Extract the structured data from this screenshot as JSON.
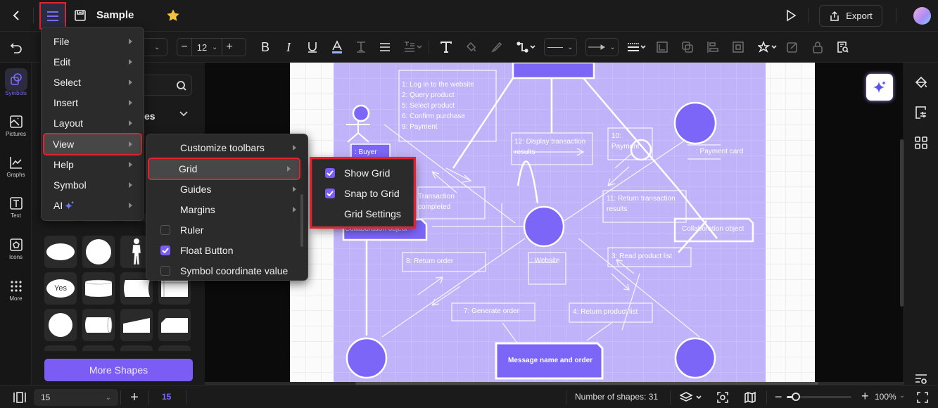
{
  "app": {
    "document_title": "Sample",
    "export_label": "Export"
  },
  "toolbar": {
    "font_size": "12",
    "line_style": "solid",
    "arrow_style": "arrow"
  },
  "left_rail": {
    "items": [
      {
        "label": "Symbols",
        "icon": "symbols-icon",
        "active": true
      },
      {
        "label": "Pictures",
        "icon": "pictures-icon"
      },
      {
        "label": "Graphs",
        "icon": "graphs-icon"
      },
      {
        "label": "Text",
        "icon": "text-icon"
      },
      {
        "label": "Icons",
        "icon": "icons-icon"
      },
      {
        "label": "More",
        "icon": "more-icon"
      }
    ]
  },
  "left_panel": {
    "section_partial_label": "es",
    "yes_shape_label": "Yes",
    "more_shapes_label": "More Shapes"
  },
  "main_menu": {
    "items": [
      {
        "label": "File"
      },
      {
        "label": "Edit"
      },
      {
        "label": "Select"
      },
      {
        "label": "Insert"
      },
      {
        "label": "Layout"
      },
      {
        "label": "View",
        "highlighted": true
      },
      {
        "label": "Help"
      },
      {
        "label": "Symbol"
      },
      {
        "label": "AI"
      }
    ]
  },
  "view_menu": {
    "items": [
      {
        "label": "Customize toolbars",
        "type": "submenu"
      },
      {
        "label": "Grid",
        "type": "submenu",
        "highlighted": true
      },
      {
        "label": "Guides",
        "type": "submenu"
      },
      {
        "label": "Margins",
        "type": "submenu"
      },
      {
        "label": "Ruler",
        "type": "checkbox",
        "checked": false
      },
      {
        "label": "Float Button",
        "type": "checkbox",
        "checked": true
      },
      {
        "label": "Symbol coordinate value",
        "type": "checkbox",
        "checked": false
      }
    ]
  },
  "grid_menu": {
    "items": [
      {
        "label": "Show Grid",
        "checked": true
      },
      {
        "label": "Snap to Grid",
        "checked": true
      },
      {
        "label": "Grid Settings"
      }
    ]
  },
  "diagram": {
    "note_messages": [
      "1: Log in to the website",
      "2: Query product",
      "5: Select product",
      "6: Confirm purchase",
      "9: Payment"
    ],
    "buyer_label": ": Buyer",
    "display_results": "12: Display transaction results",
    "payment_label": "10: Payment",
    "payment_card_label": ": Payment card",
    "transaction_completed": "Transaction completed",
    "return_transaction": "11: Return transaction results",
    "collab_left": "Collaboration object",
    "collab_right": "Collaboration object",
    "website_label": ": Website",
    "return_order": "8: Return order",
    "read_product_list": "3: Read product list",
    "generate_order": "7: Generate order",
    "return_product_list": "4: Return product list",
    "message_name_order": "Message name and order"
  },
  "statusbar": {
    "page_select": "15",
    "page_number": "15",
    "shapes_count": "Number of shapes: 31",
    "zoom": "100%",
    "zoom_fraction": 0.1
  },
  "colors": {
    "accent": "#7b5cf5",
    "highlight_outline": "#e0242f",
    "diagram_bg": "#c0b3f9",
    "node_fill": "#7b66f7"
  }
}
